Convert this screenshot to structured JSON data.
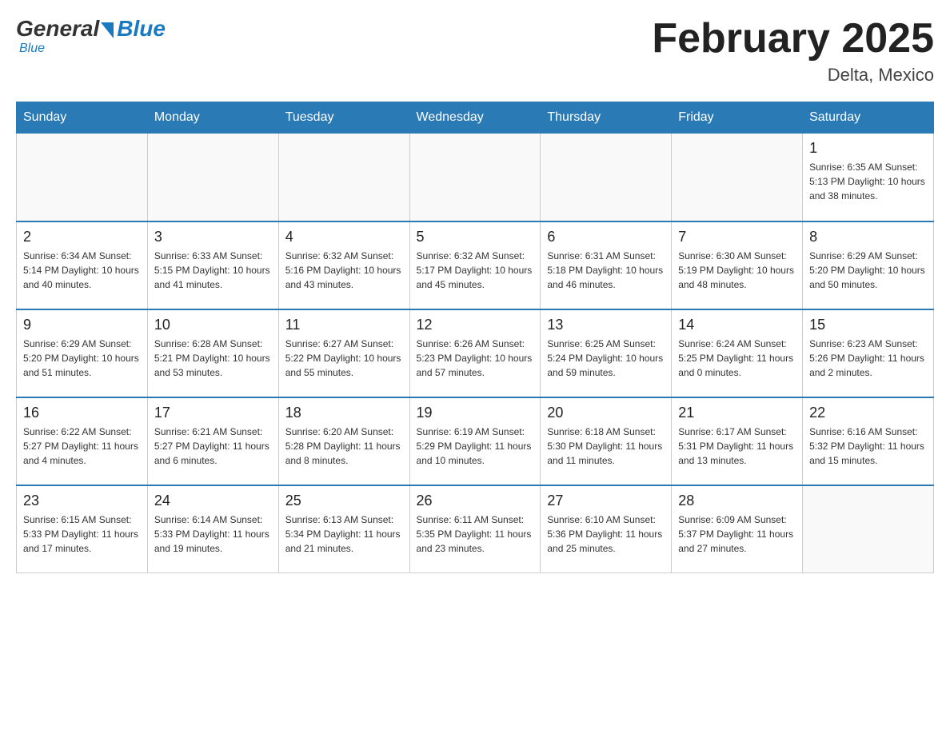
{
  "logo": {
    "general": "General",
    "blue": "Blue"
  },
  "title": "February 2025",
  "subtitle": "Delta, Mexico",
  "days": [
    "Sunday",
    "Monday",
    "Tuesday",
    "Wednesday",
    "Thursday",
    "Friday",
    "Saturday"
  ],
  "weeks": [
    [
      {
        "day": "",
        "info": ""
      },
      {
        "day": "",
        "info": ""
      },
      {
        "day": "",
        "info": ""
      },
      {
        "day": "",
        "info": ""
      },
      {
        "day": "",
        "info": ""
      },
      {
        "day": "",
        "info": ""
      },
      {
        "day": "1",
        "info": "Sunrise: 6:35 AM\nSunset: 5:13 PM\nDaylight: 10 hours\nand 38 minutes."
      }
    ],
    [
      {
        "day": "2",
        "info": "Sunrise: 6:34 AM\nSunset: 5:14 PM\nDaylight: 10 hours\nand 40 minutes."
      },
      {
        "day": "3",
        "info": "Sunrise: 6:33 AM\nSunset: 5:15 PM\nDaylight: 10 hours\nand 41 minutes."
      },
      {
        "day": "4",
        "info": "Sunrise: 6:32 AM\nSunset: 5:16 PM\nDaylight: 10 hours\nand 43 minutes."
      },
      {
        "day": "5",
        "info": "Sunrise: 6:32 AM\nSunset: 5:17 PM\nDaylight: 10 hours\nand 45 minutes."
      },
      {
        "day": "6",
        "info": "Sunrise: 6:31 AM\nSunset: 5:18 PM\nDaylight: 10 hours\nand 46 minutes."
      },
      {
        "day": "7",
        "info": "Sunrise: 6:30 AM\nSunset: 5:19 PM\nDaylight: 10 hours\nand 48 minutes."
      },
      {
        "day": "8",
        "info": "Sunrise: 6:29 AM\nSunset: 5:20 PM\nDaylight: 10 hours\nand 50 minutes."
      }
    ],
    [
      {
        "day": "9",
        "info": "Sunrise: 6:29 AM\nSunset: 5:20 PM\nDaylight: 10 hours\nand 51 minutes."
      },
      {
        "day": "10",
        "info": "Sunrise: 6:28 AM\nSunset: 5:21 PM\nDaylight: 10 hours\nand 53 minutes."
      },
      {
        "day": "11",
        "info": "Sunrise: 6:27 AM\nSunset: 5:22 PM\nDaylight: 10 hours\nand 55 minutes."
      },
      {
        "day": "12",
        "info": "Sunrise: 6:26 AM\nSunset: 5:23 PM\nDaylight: 10 hours\nand 57 minutes."
      },
      {
        "day": "13",
        "info": "Sunrise: 6:25 AM\nSunset: 5:24 PM\nDaylight: 10 hours\nand 59 minutes."
      },
      {
        "day": "14",
        "info": "Sunrise: 6:24 AM\nSunset: 5:25 PM\nDaylight: 11 hours\nand 0 minutes."
      },
      {
        "day": "15",
        "info": "Sunrise: 6:23 AM\nSunset: 5:26 PM\nDaylight: 11 hours\nand 2 minutes."
      }
    ],
    [
      {
        "day": "16",
        "info": "Sunrise: 6:22 AM\nSunset: 5:27 PM\nDaylight: 11 hours\nand 4 minutes."
      },
      {
        "day": "17",
        "info": "Sunrise: 6:21 AM\nSunset: 5:27 PM\nDaylight: 11 hours\nand 6 minutes."
      },
      {
        "day": "18",
        "info": "Sunrise: 6:20 AM\nSunset: 5:28 PM\nDaylight: 11 hours\nand 8 minutes."
      },
      {
        "day": "19",
        "info": "Sunrise: 6:19 AM\nSunset: 5:29 PM\nDaylight: 11 hours\nand 10 minutes."
      },
      {
        "day": "20",
        "info": "Sunrise: 6:18 AM\nSunset: 5:30 PM\nDaylight: 11 hours\nand 11 minutes."
      },
      {
        "day": "21",
        "info": "Sunrise: 6:17 AM\nSunset: 5:31 PM\nDaylight: 11 hours\nand 13 minutes."
      },
      {
        "day": "22",
        "info": "Sunrise: 6:16 AM\nSunset: 5:32 PM\nDaylight: 11 hours\nand 15 minutes."
      }
    ],
    [
      {
        "day": "23",
        "info": "Sunrise: 6:15 AM\nSunset: 5:33 PM\nDaylight: 11 hours\nand 17 minutes."
      },
      {
        "day": "24",
        "info": "Sunrise: 6:14 AM\nSunset: 5:33 PM\nDaylight: 11 hours\nand 19 minutes."
      },
      {
        "day": "25",
        "info": "Sunrise: 6:13 AM\nSunset: 5:34 PM\nDaylight: 11 hours\nand 21 minutes."
      },
      {
        "day": "26",
        "info": "Sunrise: 6:11 AM\nSunset: 5:35 PM\nDaylight: 11 hours\nand 23 minutes."
      },
      {
        "day": "27",
        "info": "Sunrise: 6:10 AM\nSunset: 5:36 PM\nDaylight: 11 hours\nand 25 minutes."
      },
      {
        "day": "28",
        "info": "Sunrise: 6:09 AM\nSunset: 5:37 PM\nDaylight: 11 hours\nand 27 minutes."
      },
      {
        "day": "",
        "info": ""
      }
    ]
  ]
}
